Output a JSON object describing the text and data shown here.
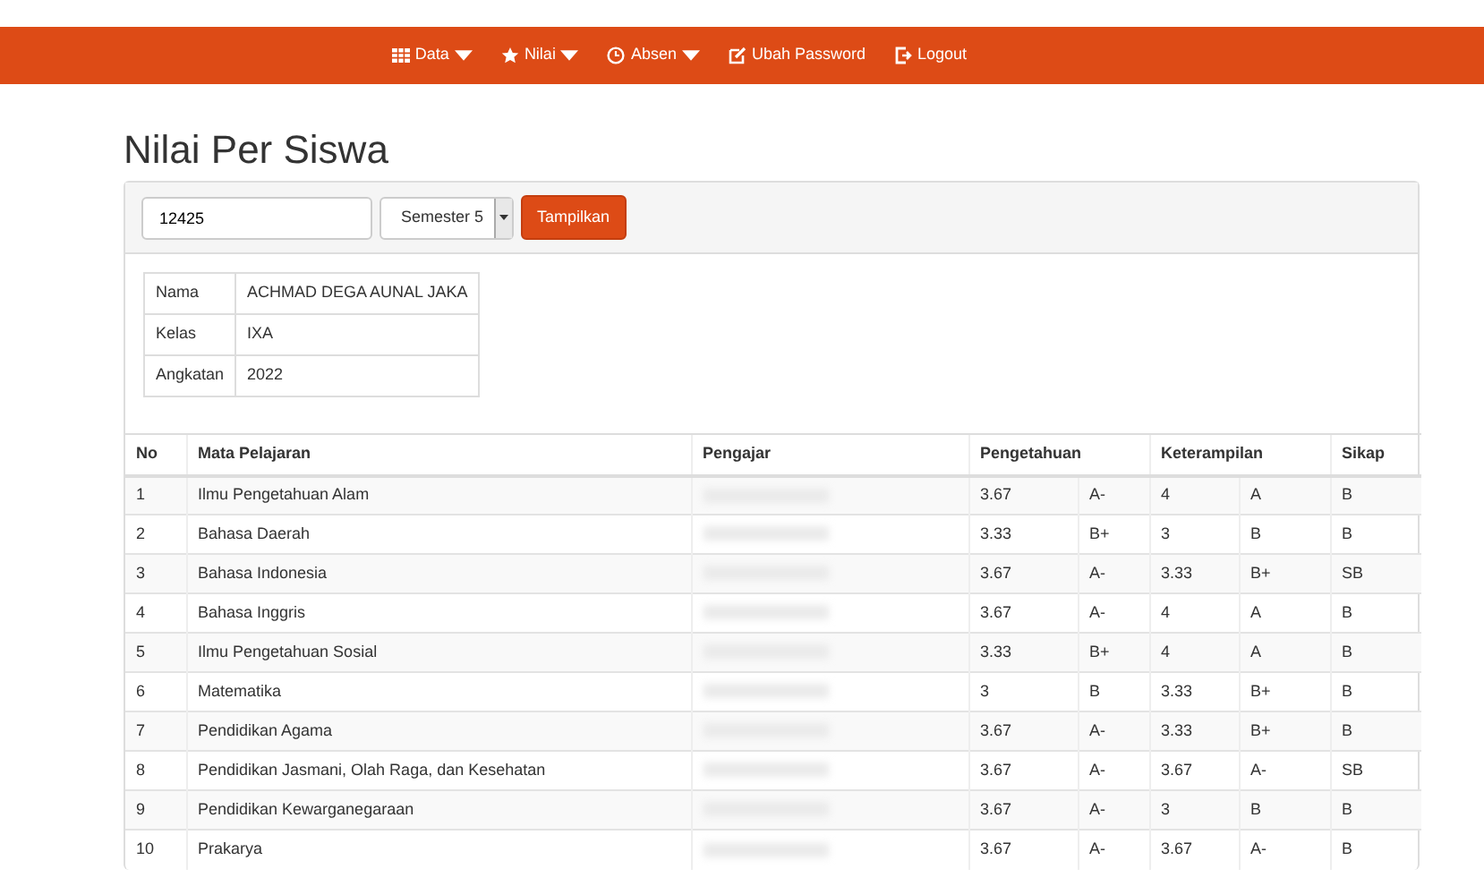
{
  "navbar": {
    "items": [
      {
        "label": "Data",
        "dropdown": true
      },
      {
        "label": "Nilai",
        "dropdown": true
      },
      {
        "label": "Absen",
        "dropdown": true
      },
      {
        "label": "Ubah Password",
        "dropdown": false
      },
      {
        "label": "Logout",
        "dropdown": false
      }
    ]
  },
  "page_title": "Nilai Per Siswa",
  "filter": {
    "student_id": "12425",
    "semester": "Semester 5",
    "button": "Tampilkan"
  },
  "student": [
    {
      "label": "Nama",
      "value": "ACHMAD DEGA AUNAL JAKA"
    },
    {
      "label": "Kelas",
      "value": "IXA"
    },
    {
      "label": "Angkatan",
      "value": "2022"
    }
  ],
  "table": {
    "columns": [
      "No",
      "Mata Pelajaran",
      "Pengajar",
      "Pengetahuan",
      "Keterampilan",
      "Sikap"
    ],
    "rows": [
      {
        "no": "1",
        "subject": "Ilmu Pengetahuan Alam",
        "p_score": "3.67",
        "p_grade": "A-",
        "k_score": "4",
        "k_grade": "A",
        "sikap": "B"
      },
      {
        "no": "2",
        "subject": "Bahasa Daerah",
        "p_score": "3.33",
        "p_grade": "B+",
        "k_score": "3",
        "k_grade": "B",
        "sikap": "B"
      },
      {
        "no": "3",
        "subject": "Bahasa Indonesia",
        "p_score": "3.67",
        "p_grade": "A-",
        "k_score": "3.33",
        "k_grade": "B+",
        "sikap": "SB"
      },
      {
        "no": "4",
        "subject": "Bahasa Inggris",
        "p_score": "3.67",
        "p_grade": "A-",
        "k_score": "4",
        "k_grade": "A",
        "sikap": "B"
      },
      {
        "no": "5",
        "subject": "Ilmu Pengetahuan Sosial",
        "p_score": "3.33",
        "p_grade": "B+",
        "k_score": "4",
        "k_grade": "A",
        "sikap": "B"
      },
      {
        "no": "6",
        "subject": "Matematika",
        "p_score": "3",
        "p_grade": "B",
        "k_score": "3.33",
        "k_grade": "B+",
        "sikap": "B"
      },
      {
        "no": "7",
        "subject": "Pendidikan Agama",
        "p_score": "3.67",
        "p_grade": "A-",
        "k_score": "3.33",
        "k_grade": "B+",
        "sikap": "B"
      },
      {
        "no": "8",
        "subject": "Pendidikan Jasmani, Olah Raga, dan Kesehatan",
        "p_score": "3.67",
        "p_grade": "A-",
        "k_score": "3.67",
        "k_grade": "A-",
        "sikap": "SB"
      },
      {
        "no": "9",
        "subject": "Pendidikan Kewarganegaraan",
        "p_score": "3.67",
        "p_grade": "A-",
        "k_score": "3",
        "k_grade": "B",
        "sikap": "B"
      },
      {
        "no": "10",
        "subject": "Prakarya",
        "p_score": "3.67",
        "p_grade": "A-",
        "k_score": "3.67",
        "k_grade": "A-",
        "sikap": "B"
      }
    ]
  }
}
